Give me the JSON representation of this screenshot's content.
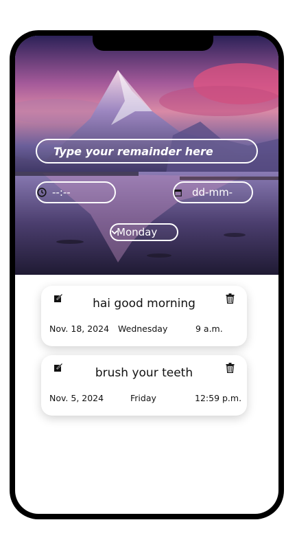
{
  "form": {
    "reminder_placeholder": "Type your remainder here",
    "time_value": "--:--",
    "date_value": "dd-mm-",
    "day_selected": "Monday"
  },
  "reminders": [
    {
      "title": "hai good morning",
      "date": "Nov. 18, 2024",
      "day": "Wednesday",
      "time": "9 a.m."
    },
    {
      "title": "brush your teeth",
      "date": "Nov. 5, 2024",
      "day": "Friday",
      "time": "12:59 p.m."
    }
  ],
  "icons": {
    "edit": "edit-icon",
    "delete": "trash-icon",
    "time": "clock-icon",
    "date": "calendar-icon",
    "dropdown": "chevron-down-icon"
  }
}
